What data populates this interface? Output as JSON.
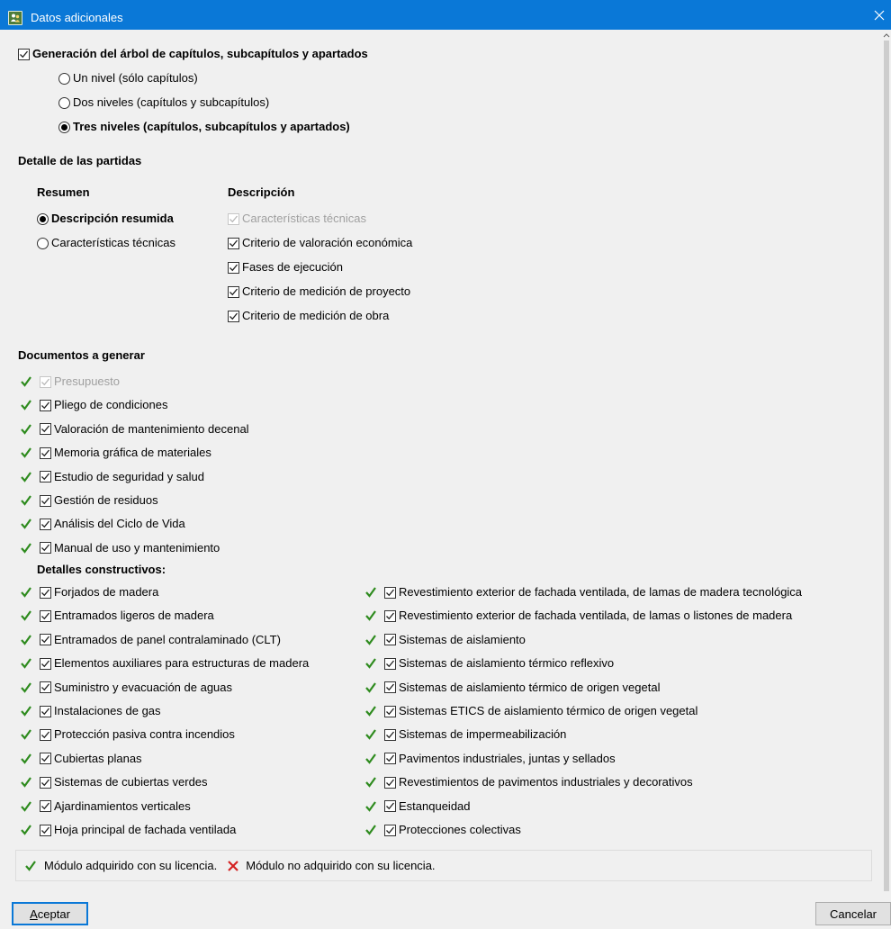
{
  "window": {
    "title": "Datos adicionales",
    "app_icon": "people-icon",
    "close_icon": "close-icon",
    "accent_color": "#0a78d7"
  },
  "tree": {
    "checkbox_label": "Generación del árbol de capítulos, subcapítulos y apartados",
    "checked": true,
    "options": [
      {
        "label": "Un nivel (sólo capítulos)",
        "selected": false
      },
      {
        "label": "Dos niveles (capítulos y subcapítulos)",
        "selected": false
      },
      {
        "label": "Tres niveles (capítulos, subcapítulos y apartados)",
        "selected": true
      }
    ]
  },
  "detail": {
    "heading": "Detalle de las partidas",
    "summary": {
      "heading": "Resumen",
      "options": [
        {
          "label": "Descripción resumida",
          "selected": true
        },
        {
          "label": "Características técnicas",
          "selected": false
        }
      ]
    },
    "description": {
      "heading": "Descripción",
      "items": [
        {
          "label": "Características técnicas",
          "checked": true,
          "disabled": true
        },
        {
          "label": "Criterio de valoración económica",
          "checked": true,
          "disabled": false
        },
        {
          "label": "Fases de ejecución",
          "checked": true,
          "disabled": false
        },
        {
          "label": "Criterio de medición de proyecto",
          "checked": true,
          "disabled": false
        },
        {
          "label": "Criterio de medición de obra",
          "checked": true,
          "disabled": false
        }
      ]
    }
  },
  "documents": {
    "heading": "Documentos a generar",
    "items": [
      {
        "label": "Presupuesto",
        "checked": true,
        "disabled": true,
        "licensed": true
      },
      {
        "label": "Pliego de condiciones",
        "checked": true,
        "disabled": false,
        "licensed": true
      },
      {
        "label": "Valoración de mantenimiento decenal",
        "checked": true,
        "disabled": false,
        "licensed": true
      },
      {
        "label": "Memoria gráfica de materiales",
        "checked": true,
        "disabled": false,
        "licensed": true
      },
      {
        "label": "Estudio de seguridad y salud",
        "checked": true,
        "disabled": false,
        "licensed": true
      },
      {
        "label": "Gestión de residuos",
        "checked": true,
        "disabled": false,
        "licensed": true
      },
      {
        "label": "Análisis del Ciclo de Vida",
        "checked": true,
        "disabled": false,
        "licensed": true
      },
      {
        "label": "Manual de uso y mantenimiento",
        "checked": true,
        "disabled": false,
        "licensed": true
      }
    ],
    "constructive": {
      "heading": "Detalles constructivos:",
      "left": [
        "Forjados de madera",
        "Entramados ligeros de madera",
        "Entramados de panel contralaminado (CLT)",
        "Elementos auxiliares para estructuras de madera",
        "Suministro y evacuación de aguas",
        "Instalaciones de gas",
        "Protección pasiva contra incendios",
        "Cubiertas planas",
        "Sistemas de cubiertas verdes",
        "Ajardinamientos verticales",
        "Hoja principal de fachada ventilada"
      ],
      "right": [
        "Revestimiento exterior de fachada ventilada, de lamas de madera tecnológica",
        "Revestimiento exterior de fachada ventilada, de lamas o listones de madera",
        "Sistemas de aislamiento",
        "Sistemas de aislamiento térmico reflexivo",
        "Sistemas de aislamiento térmico de origen vegetal",
        "Sistemas ETICS de aislamiento térmico de origen vegetal",
        "Sistemas de impermeabilización",
        "Pavimentos industriales, juntas y sellados",
        "Revestimientos de pavimentos industriales y decorativos",
        "Estanqueidad",
        "Protecciones colectivas"
      ]
    }
  },
  "legend": {
    "licensed_label": "Módulo adquirido con su licencia.",
    "unlicensed_label": "Módulo no adquirido con su licencia.",
    "licensed_color": "#2e8b1e",
    "unlicensed_color": "#d42020"
  },
  "buttons": {
    "accept_first": "A",
    "accept_rest": "ceptar",
    "cancel": "Cancelar"
  }
}
